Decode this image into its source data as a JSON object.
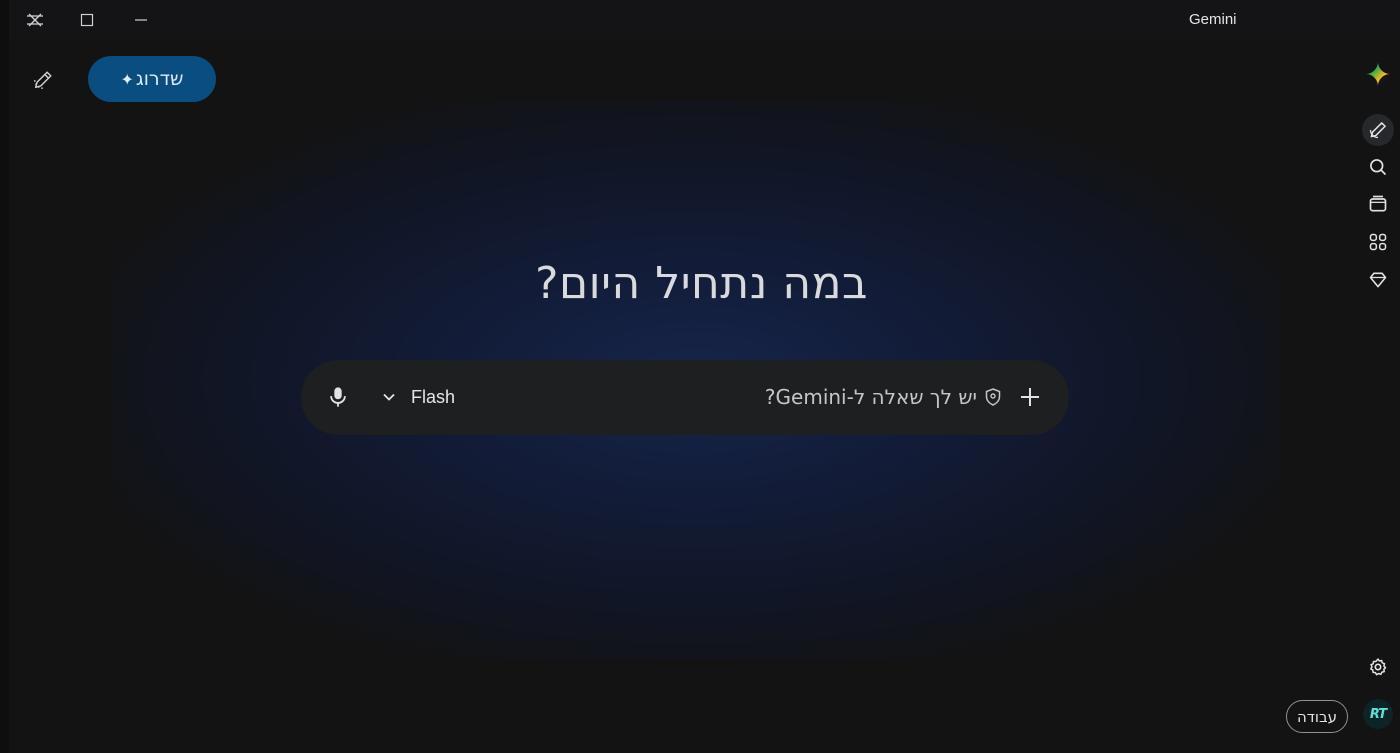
{
  "window": {
    "title": "Gemini",
    "controls": [
      "minimize",
      "maximize",
      "close"
    ]
  },
  "header": {
    "upgrade_label": "שדרוג",
    "upgrade_icon": "sparkle-icon",
    "new_chat_icon": "edit-icon"
  },
  "rail": {
    "items": [
      {
        "name": "gemini-logo-icon"
      },
      {
        "name": "new-chat-icon",
        "active": true
      },
      {
        "name": "search-icon"
      },
      {
        "name": "gallery-icon"
      },
      {
        "name": "apps-icon"
      },
      {
        "name": "gem-icon"
      }
    ]
  },
  "main": {
    "headline": "במה נתחיל היום?"
  },
  "prompt": {
    "placeholder": "יש לך שאלה ל-Gemini?",
    "model_label": "Flash",
    "mic_icon": "microphone-icon",
    "add_icon": "plus-icon",
    "privacy_icon": "shield-icon"
  },
  "footer": {
    "work_chip_label": "עבודה",
    "avatar_initials": "RT"
  },
  "colors": {
    "upgrade_bg": "#0a4d80",
    "glow": "#16254a",
    "background": "#131314",
    "promptbar_bg": "#1e1f21"
  }
}
